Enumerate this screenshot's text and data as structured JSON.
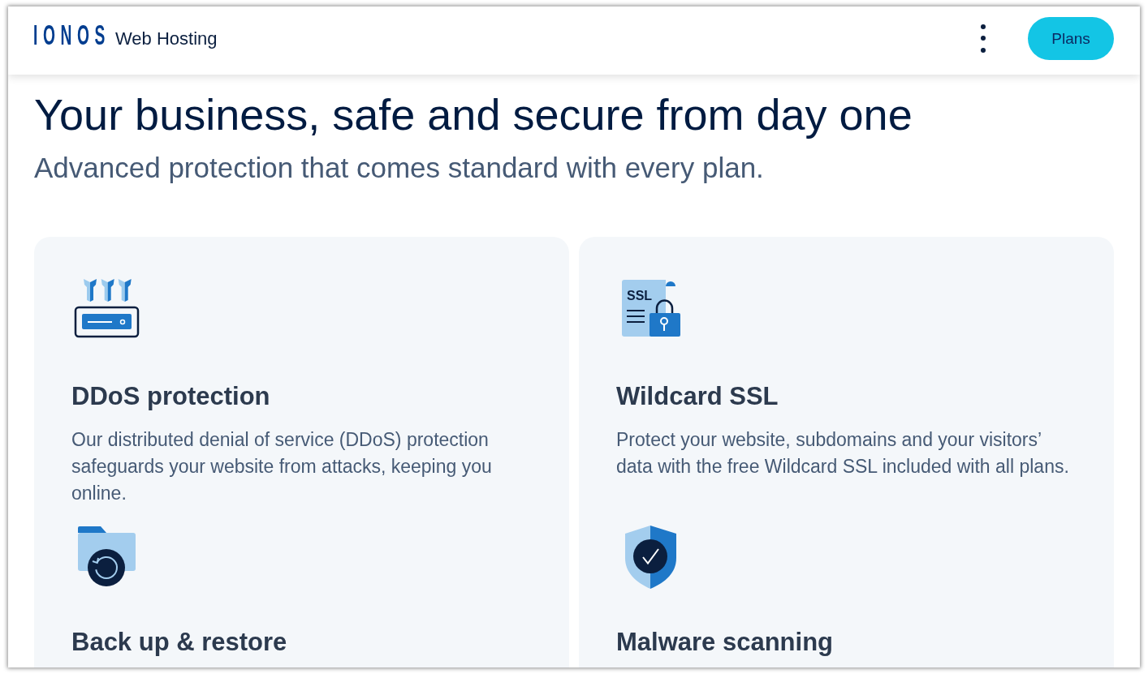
{
  "header": {
    "logo": "IONOS",
    "product": "Web Hosting",
    "button": "Plans"
  },
  "hero": {
    "title": "Your business, safe and secure from day one",
    "subtitle": "Advanced protection that comes standard with every plan."
  },
  "cards": [
    {
      "features": [
        {
          "kind": "servers",
          "title": "DDoS protection",
          "description": "Our distributed denial of service (DDoS) protection safeguards your website from attacks, keeping you online."
        },
        {
          "kind": "folder",
          "title": "Back up & restore"
        }
      ]
    },
    {
      "features": [
        {
          "kind": "certificate",
          "icon_label": "SSL",
          "title": "Wildcard SSL",
          "description": "Protect your website, subdomains and your visitors’ data with the free Wildcard SSL included with all plans."
        },
        {
          "kind": "shield",
          "title": "Malware scanning"
        }
      ]
    }
  ]
}
